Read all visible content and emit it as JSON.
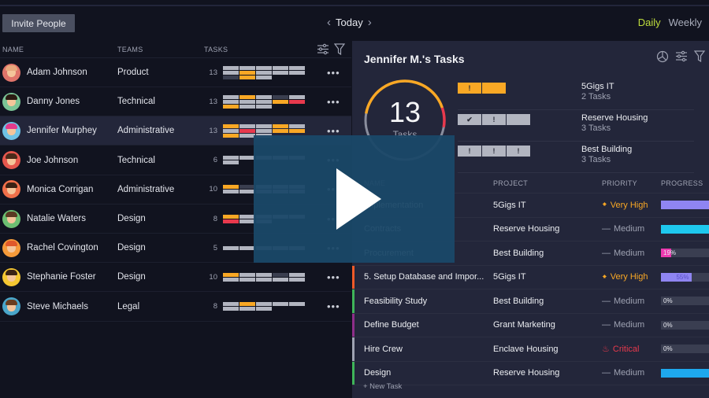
{
  "toolbar": {
    "invite_label": "Invite People",
    "date_label": "Today",
    "prev_icon": "chevron-left-icon",
    "next_icon": "chevron-right-icon",
    "range": {
      "daily": "Daily",
      "weekly": "Weekly",
      "active": "Daily"
    }
  },
  "people": {
    "columns": {
      "name": "NAME",
      "teams": "TEAMS",
      "tasks": "TASKS"
    },
    "rows": [
      {
        "name": "Adam Johnson",
        "team": "Product",
        "count": "13",
        "blocks": [
          "g",
          "g",
          "g",
          "g",
          "g",
          "g",
          "o",
          "g",
          "g",
          "g",
          "d",
          "o",
          "g"
        ],
        "avatar": "#e0746a",
        "hair": "#e8a97d",
        "selected": false
      },
      {
        "name": "Danny Jones",
        "team": "Technical",
        "count": "13",
        "blocks": [
          "g",
          "o",
          "g",
          "d",
          "g",
          "g",
          "g",
          "g",
          "o",
          "r",
          "o",
          "g",
          "g"
        ],
        "avatar": "#7bc496",
        "hair": "#2b1a12",
        "selected": false
      },
      {
        "name": "Jennifer Murphey",
        "team": "Administrative",
        "count": "13",
        "blocks": [
          "o",
          "g",
          "g",
          "o",
          "g",
          "g",
          "r",
          "g",
          "o",
          "o",
          "o",
          "g",
          "g"
        ],
        "avatar": "#6fc2e5",
        "hair": "#e33b8c",
        "selected": true
      },
      {
        "name": "Joe Johnson",
        "team": "Technical",
        "count": "6",
        "blocks": [
          "g",
          "g",
          "g",
          "g",
          "g",
          "g"
        ],
        "avatar": "#e5574d",
        "hair": "#4a2a1a",
        "selected": false
      },
      {
        "name": "Monica Corrigan",
        "team": "Administrative",
        "count": "10",
        "blocks": [
          "o",
          "d",
          "g",
          "g",
          "g",
          "g",
          "g",
          "g",
          "g",
          "g"
        ],
        "avatar": "#f0704a",
        "hair": "#3a2214",
        "selected": false
      },
      {
        "name": "Natalie Waters",
        "team": "Design",
        "count": "8",
        "blocks": [
          "o",
          "g",
          "g",
          "g",
          "g",
          "r",
          "g",
          "g"
        ],
        "avatar": "#6dbf72",
        "hair": "#5a3a22",
        "selected": false
      },
      {
        "name": "Rachel Covington",
        "team": "Design",
        "count": "5",
        "blocks": [
          "g",
          "g",
          "g",
          "g",
          "g"
        ],
        "avatar": "#f59a3a",
        "hair": "#e0582a",
        "selected": false
      },
      {
        "name": "Stephanie Foster",
        "team": "Design",
        "count": "10",
        "blocks": [
          "o",
          "g",
          "g",
          "d",
          "g",
          "g",
          "g",
          "g",
          "g",
          "g"
        ],
        "avatar": "#f5c732",
        "hair": "#3a2214",
        "selected": false
      },
      {
        "name": "Steve Michaels",
        "team": "Legal",
        "count": "8",
        "blocks": [
          "g",
          "o",
          "g",
          "g",
          "g",
          "g",
          "g",
          "g"
        ],
        "avatar": "#4aa6c9",
        "hair": "#6a3e1e",
        "selected": false
      }
    ]
  },
  "detail": {
    "title": "Jennifer M.'s Tasks",
    "total": "13",
    "total_label": "Tasks",
    "ring": {
      "orange": 0.42,
      "red": 0.08,
      "gray": 0.5
    },
    "projects": [
      {
        "name": "5Gigs IT",
        "count": "2 Tasks",
        "boxes": [
          {
            "c": "ob",
            "t": "!"
          },
          {
            "c": "ob",
            "t": ""
          }
        ]
      },
      {
        "name": "Reserve Housing",
        "count": "3 Tasks",
        "boxes": [
          {
            "c": "gb",
            "t": "✔"
          },
          {
            "c": "gb",
            "t": "!"
          },
          {
            "c": "gb",
            "t": ""
          }
        ]
      },
      {
        "name": "Best Building",
        "count": "3 Tasks",
        "boxes": [
          {
            "c": "gb",
            "t": "!"
          },
          {
            "c": "gb",
            "t": "!"
          },
          {
            "c": "gb",
            "t": "!"
          }
        ]
      }
    ],
    "columns": {
      "name": "NAME",
      "project": "PROJECT",
      "priority": "PRIORITY",
      "progress": "PROGRESS"
    },
    "tasks": [
      {
        "name": "Implementation",
        "project": "5Gigs IT",
        "priority": "Very High",
        "level": "vhigh",
        "progress": 100,
        "label": "",
        "color": "#8f85f2",
        "strip": ""
      },
      {
        "name": "Contracts",
        "project": "Reserve Housing",
        "priority": "Medium",
        "level": "med",
        "progress": 100,
        "label": "",
        "color": "#1ec8ee",
        "strip": ""
      },
      {
        "name": "Procurement",
        "project": "Best Building",
        "priority": "Medium",
        "level": "med",
        "progress": 19,
        "label": "19%",
        "color": "#ec3ab0",
        "strip": ""
      },
      {
        "name": "5. Setup Database and Impor...",
        "project": "5Gigs IT",
        "priority": "Very High",
        "level": "vhigh",
        "progress": 55,
        "label": "55%",
        "color": "#8f85f2",
        "strip": "#f05a28"
      },
      {
        "name": "Feasibility Study",
        "project": "Best Building",
        "priority": "Medium",
        "level": "med",
        "progress": 0,
        "label": "0%",
        "color": "#8f85f2",
        "strip": "#3fb559"
      },
      {
        "name": "Define Budget",
        "project": "Grant Marketing",
        "priority": "Medium",
        "level": "med",
        "progress": 0,
        "label": "0%",
        "color": "#8f85f2",
        "strip": "#8e2e8a"
      },
      {
        "name": "Hire Crew",
        "project": "Enclave Housing",
        "priority": "Critical",
        "level": "crit",
        "progress": 0,
        "label": "0%",
        "color": "#8f85f2",
        "strip": "#9ea2b2"
      },
      {
        "name": "Design",
        "project": "Reserve Housing",
        "priority": "Medium",
        "level": "med",
        "progress": 100,
        "label": "",
        "color": "#1ea8ee",
        "strip": "#3fb559"
      }
    ],
    "new_task": "+ New Task"
  },
  "video": {
    "play_icon": "play-icon"
  }
}
